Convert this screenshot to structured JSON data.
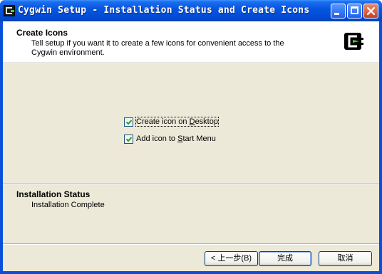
{
  "window": {
    "title": "Cygwin Setup - Installation Status and Create Icons",
    "app_icon": "cygwin-icon",
    "controls": [
      "minimize-icon",
      "maximize-icon",
      "close-icon"
    ]
  },
  "header": {
    "title": "Create Icons",
    "description": "Tell setup if you want it to create a few icons for convenient access to the Cygwin environment.",
    "logo": "cygwin-logo"
  },
  "options": [
    {
      "label_pre": "Create icon on ",
      "label_underline": "D",
      "label_post": "esktop",
      "checked": true
    },
    {
      "label_pre": "Add icon to ",
      "label_underline": "S",
      "label_post": "tart Menu",
      "checked": true
    }
  ],
  "status": {
    "title": "Installation Status",
    "text": "Installation Complete"
  },
  "buttons": {
    "back": "< 上一步(B)",
    "finish": "完成",
    "cancel": "取消"
  },
  "colors": {
    "titlebar": "#0054e3",
    "dialog_bg": "#ece9d8",
    "check_green": "#21a121"
  }
}
